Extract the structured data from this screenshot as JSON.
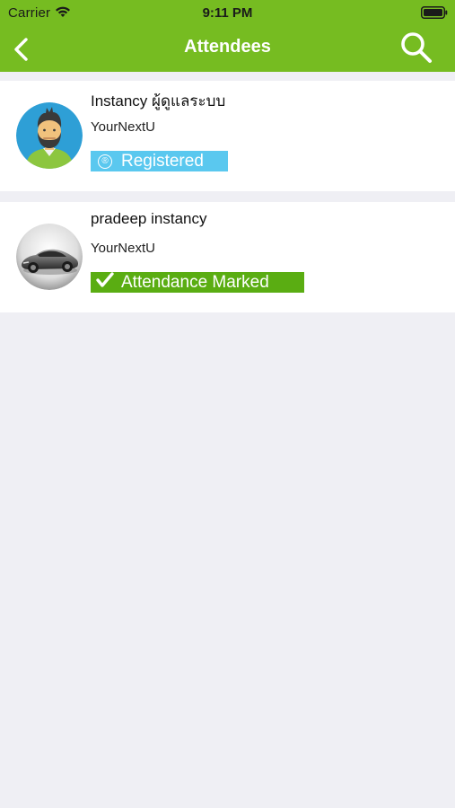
{
  "status_bar": {
    "carrier": "Carrier",
    "time": "9:11 PM"
  },
  "nav": {
    "title": "Attendees",
    "back_icon": "chevron-left-icon",
    "search_icon": "search-icon"
  },
  "attendees": [
    {
      "name": "Instancy ผู้ดูแลระบบ",
      "organization": "YourNextU",
      "avatar": "person-avatar",
      "status": "Registered",
      "status_icon": "registered-icon",
      "status_color": "#5ac8ef"
    },
    {
      "name": "pradeep instancy",
      "organization": "YourNextU",
      "avatar": "car-avatar",
      "status": "Attendance Marked",
      "status_icon": "checkmark-icon",
      "status_color": "#5aad12"
    }
  ],
  "colors": {
    "header": "#76bc21",
    "background": "#efeff4",
    "row": "#ffffff"
  }
}
